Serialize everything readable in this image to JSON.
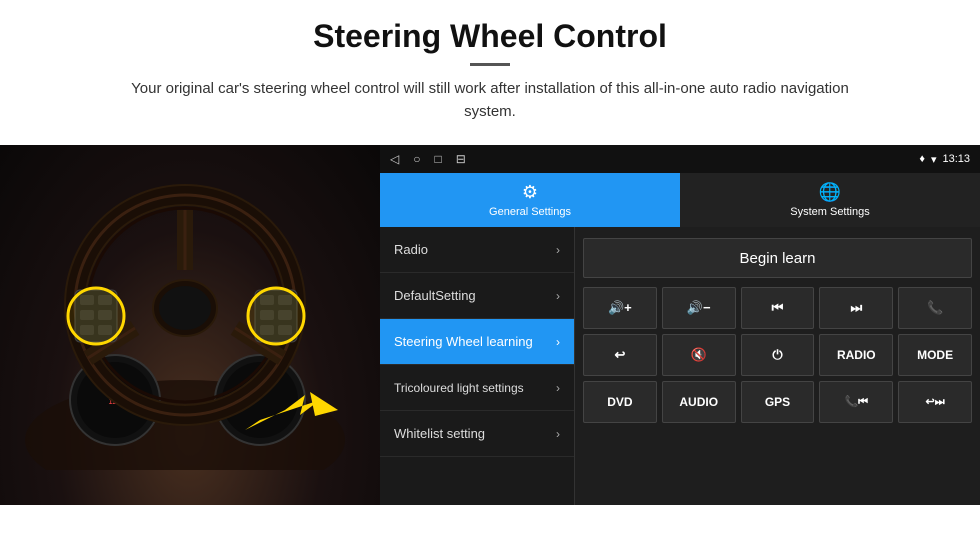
{
  "header": {
    "title": "Steering Wheel Control",
    "subtitle": "Your original car's steering wheel control will still work after installation of this all-in-one auto radio navigation system."
  },
  "status_bar": {
    "nav_back": "◁",
    "nav_home": "○",
    "nav_recent": "□",
    "nav_extra": "⊟",
    "location_icon": "♦",
    "wifi_icon": "▾",
    "time": "13:13"
  },
  "tabs": [
    {
      "id": "general",
      "label": "General Settings",
      "active": true
    },
    {
      "id": "system",
      "label": "System Settings",
      "active": false
    }
  ],
  "menu_items": [
    {
      "label": "Radio",
      "active": false
    },
    {
      "label": "DefaultSetting",
      "active": false
    },
    {
      "label": "Steering Wheel learning",
      "active": true
    },
    {
      "label": "Tricoloured light settings",
      "active": false
    },
    {
      "label": "Whitelist setting",
      "active": false
    }
  ],
  "begin_learn_btn": "Begin learn",
  "control_rows": [
    [
      {
        "label": "🔊+",
        "type": "icon"
      },
      {
        "label": "🔊−",
        "type": "icon"
      },
      {
        "label": "⏮",
        "type": "icon"
      },
      {
        "label": "⏭",
        "type": "icon"
      },
      {
        "label": "📞",
        "type": "icon"
      }
    ],
    [
      {
        "label": "↩",
        "type": "icon"
      },
      {
        "label": "🔇",
        "type": "icon"
      },
      {
        "label": "⏻",
        "type": "icon"
      },
      {
        "label": "RADIO",
        "type": "text"
      },
      {
        "label": "MODE",
        "type": "text"
      }
    ],
    [
      {
        "label": "DVD",
        "type": "text"
      },
      {
        "label": "AUDIO",
        "type": "text"
      },
      {
        "label": "GPS",
        "type": "text"
      },
      {
        "label": "📞⏮",
        "type": "icon"
      },
      {
        "label": "↩⏭",
        "type": "icon"
      }
    ]
  ]
}
